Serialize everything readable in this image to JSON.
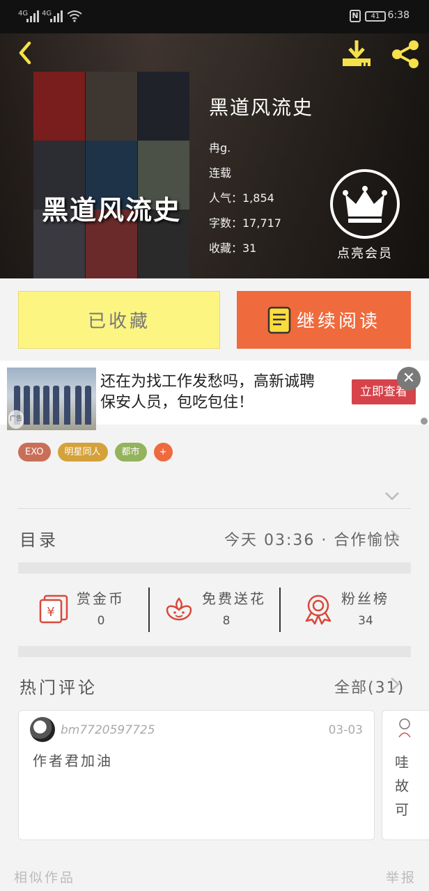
{
  "status_bar": {
    "signal_1": "4G",
    "signal_2": "4G",
    "battery": "41",
    "time": "6:38"
  },
  "book": {
    "cover_title": "黑道风流史",
    "title": "黑道风流史",
    "author": "冉g.",
    "status": "连载",
    "popularity": "人气：1,854",
    "word_count": "字数：17,717",
    "favorites": "收藏：31",
    "vip_label": "点亮会员"
  },
  "actions": {
    "collected_label": "已收藏",
    "continue_label": "继续阅读"
  },
  "ad": {
    "line1": "还在为找工作发愁吗，高新诚聘",
    "line2": "保安人员，包吃包住！",
    "cta": "立即查看",
    "tag": "广告",
    "close": "✕"
  },
  "tags": [
    {
      "label": "EXO",
      "color": "#c96f58"
    },
    {
      "label": "明星同人",
      "color": "#d4a13a"
    },
    {
      "label": "都市",
      "color": "#93b35c"
    },
    {
      "label": "+",
      "color": "#ef6a3c"
    }
  ],
  "catalog": {
    "title": "目录",
    "latest": "今天 03:36 · 合作愉快"
  },
  "stats": [
    {
      "label": "赏金币",
      "value": "0",
      "icon": "red-envelope-icon"
    },
    {
      "label": "免费送花",
      "value": "8",
      "icon": "flower-icon"
    },
    {
      "label": "粉丝榜",
      "value": "34",
      "icon": "medal-icon"
    }
  ],
  "comments": {
    "title": "热门评论",
    "all_label": "全部(31)",
    "items": [
      {
        "user": "bm7720597725",
        "date": "03-03",
        "text": "作者君加油"
      }
    ],
    "peek_chars": [
      "哇",
      "故",
      "可"
    ]
  },
  "bottom": {
    "similar": "相似作品",
    "report": "举报"
  },
  "colors": {
    "orange": "#ef6a3c",
    "yellow_button": "#fcf582",
    "icon_yellow": "#f5e24a",
    "icon_red": "#d9483a"
  }
}
